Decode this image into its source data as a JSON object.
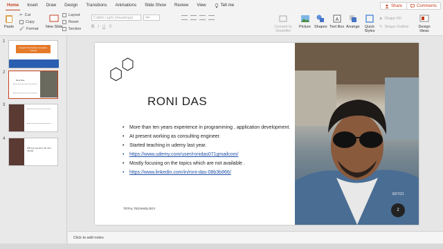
{
  "ribbon_tabs": [
    "Home",
    "Insert",
    "Draw",
    "Design",
    "Transitions",
    "Animations",
    "Slide Show",
    "Review",
    "View"
  ],
  "tell_me": "Tell me",
  "share_label": "Share",
  "comments_label": "Comments",
  "toolbar": {
    "paste": "Paste",
    "cut": "Cut",
    "copy": "Copy",
    "format": "Format",
    "new_slide": "New Slide",
    "layout": "Layout",
    "reset": "Reset",
    "section": "Section",
    "font_name": "Calibri Light (Headings)",
    "font_size": "44",
    "convert_smartart": "Convert to SmartArt",
    "picture": "Picture",
    "shapes": "Shapes",
    "text_box": "Text Box",
    "arrange": "Arrange",
    "quick_styles": "Quick Styles",
    "shape_fill": "Shape Fill",
    "shape_outline": "Shape Outline",
    "design_ideas": "Design Ideas"
  },
  "thumbnails": [
    {
      "num": "1",
      "title": "Ecopsi Print Python Complete Tutorial"
    },
    {
      "num": "2",
      "title": "Roni Das"
    },
    {
      "num": "3",
      "title": ""
    },
    {
      "num": "4",
      "title": "Will see you all in the next tutorial"
    }
  ],
  "slide": {
    "title": "RONI DAS",
    "bullets": [
      "More than ten years experience in programming , application development.",
      "At present working as consulting engineer.",
      "Started teaching in udemy last year.",
      "https://www.udemy.com/user/ronidas071gmailcom/",
      "Mostly focusing on the topics which are not available .",
      "https://www.linkedin.com/in/roni-das-08b3b866/"
    ],
    "footer": "TOTAL TECHNOLOGY",
    "date": "8/27/21",
    "page_number": "2"
  },
  "notes_placeholder": "Click to add notes",
  "colors": {
    "accent": "#c43e1c",
    "link": "#1f4ea6"
  }
}
